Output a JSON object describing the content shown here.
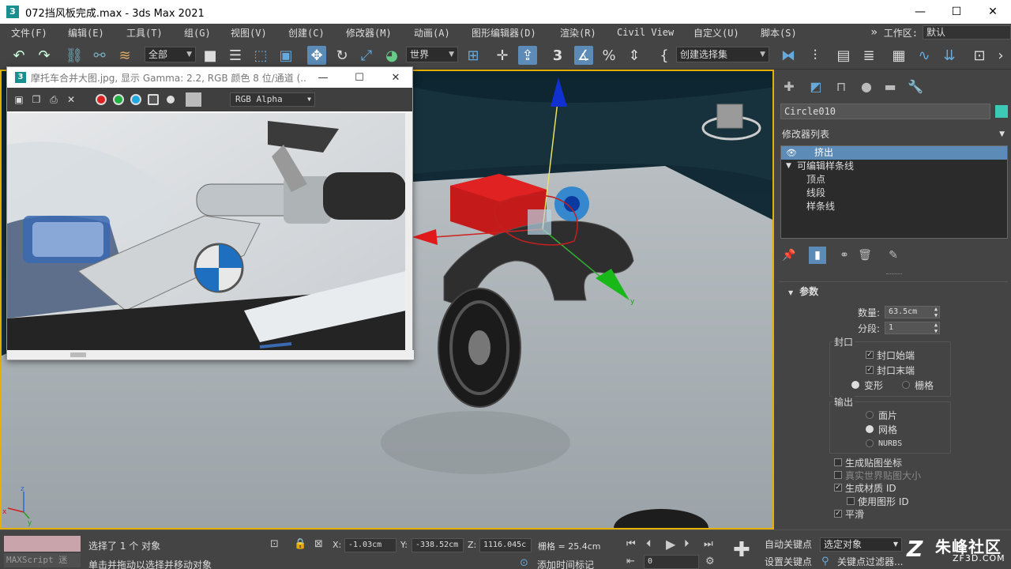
{
  "window": {
    "title": "072挡风板完成.max - 3ds Max 2021",
    "app_icon": "3",
    "minimize": "—",
    "maximize": "☐",
    "close": "✕"
  },
  "menu": {
    "items": [
      "文件(F)",
      "编辑(E)",
      "工具(T)",
      "组(G)",
      "视图(V)",
      "创建(C)",
      "修改器(M)",
      "动画(A)",
      "图形编辑器(D)",
      "渲染(R)",
      "Civil View",
      "自定义(U)",
      "脚本(S)"
    ],
    "overflow": "»",
    "workspace_label": "工作区:",
    "workspace_value": "默认"
  },
  "toolbar": {
    "selection_filter": "全部",
    "reference_coord": "世界",
    "named_selection": "创建选择集",
    "icons": [
      "undo-icon",
      "redo-icon",
      "link-icon",
      "unlink-icon",
      "bind-spacewarp-icon",
      "select-object-icon",
      "select-by-name-icon",
      "rect-selection-icon",
      "window-crossing-icon",
      "move-icon",
      "rotate-icon",
      "scale-icon",
      "placement-icon",
      "pivot-icon",
      "keyboard-shortcut-icon",
      "snap-icon",
      "angle-snap-icon",
      "percent-snap-icon",
      "spinner-snap-icon",
      "edit-named-sets-icon",
      "mirror-icon",
      "align-icon",
      "scene-explorer-icon",
      "layer-explorer-icon",
      "ribbon-icon",
      "curve-editor-icon",
      "schematic-view-icon",
      "material-editor-icon",
      "render-setup-icon"
    ]
  },
  "vfb": {
    "title": "摩托车合并大图.jpg, 显示 Gamma: 2.2, RGB 颜色 8 位/通道 (...",
    "app_icon": "3",
    "minimize": "—",
    "maximize": "☐",
    "close": "✕",
    "channel": "RGB Alpha",
    "colors": {
      "red": "#e02020",
      "green": "#20b040",
      "blue": "#20a8e0"
    }
  },
  "viewport": {
    "axis_z": "z",
    "axis_x": "x",
    "axis_y": "y"
  },
  "cmdpanel": {
    "object_name": "Circle010",
    "object_color": "#3cc9b6",
    "modifier_list": "修改器列表",
    "stack": [
      {
        "label": "挤出",
        "selected": true,
        "indent": 2
      },
      {
        "label": "可编辑样条线",
        "selected": false,
        "indent": 1
      },
      {
        "label": "顶点",
        "selected": false,
        "indent": 2
      },
      {
        "label": "线段",
        "selected": false,
        "indent": 2
      },
      {
        "label": "样条线",
        "selected": false,
        "indent": 2
      }
    ],
    "rollout_title": "参数",
    "amount_label": "数量:",
    "amount_value": "63.5cm",
    "segments_label": "分段:",
    "segments_value": "1",
    "capping_label": "封口",
    "cap_start": "封口始端",
    "cap_end": "封口末端",
    "morph": "变形",
    "grid": "栅格",
    "output_label": "输出",
    "patch": "面片",
    "mesh": "网格",
    "nurbs": "NURBS",
    "gen_map_coords": "生成贴图坐标",
    "real_world_map": "真实世界贴图大小",
    "gen_mat_ids": "生成材质 ID",
    "use_shape_ids": "使用图形 ID",
    "smooth": "平滑"
  },
  "status": {
    "maxscript": "MAXScript 迷",
    "selected": "选择了 1 个 对象",
    "prompt": "单击并拖动以选择并移动对象",
    "x_label": "X:",
    "x_value": "-1.03cm",
    "y_label": "Y:",
    "y_value": "-338.52cm",
    "z_label": "Z:",
    "z_value": "1116.045c",
    "grid": "栅格 = 25.4cm",
    "add_time_tag": "添加时间标记",
    "frame": "0",
    "auto_key": "自动关键点",
    "set_key": "设置关键点",
    "selected_obj": "选定对象",
    "key_filters": "关键点过滤器..."
  },
  "watermark": {
    "logo": "Z",
    "title": "朱峰社区",
    "url": "ZF3D.COM"
  }
}
